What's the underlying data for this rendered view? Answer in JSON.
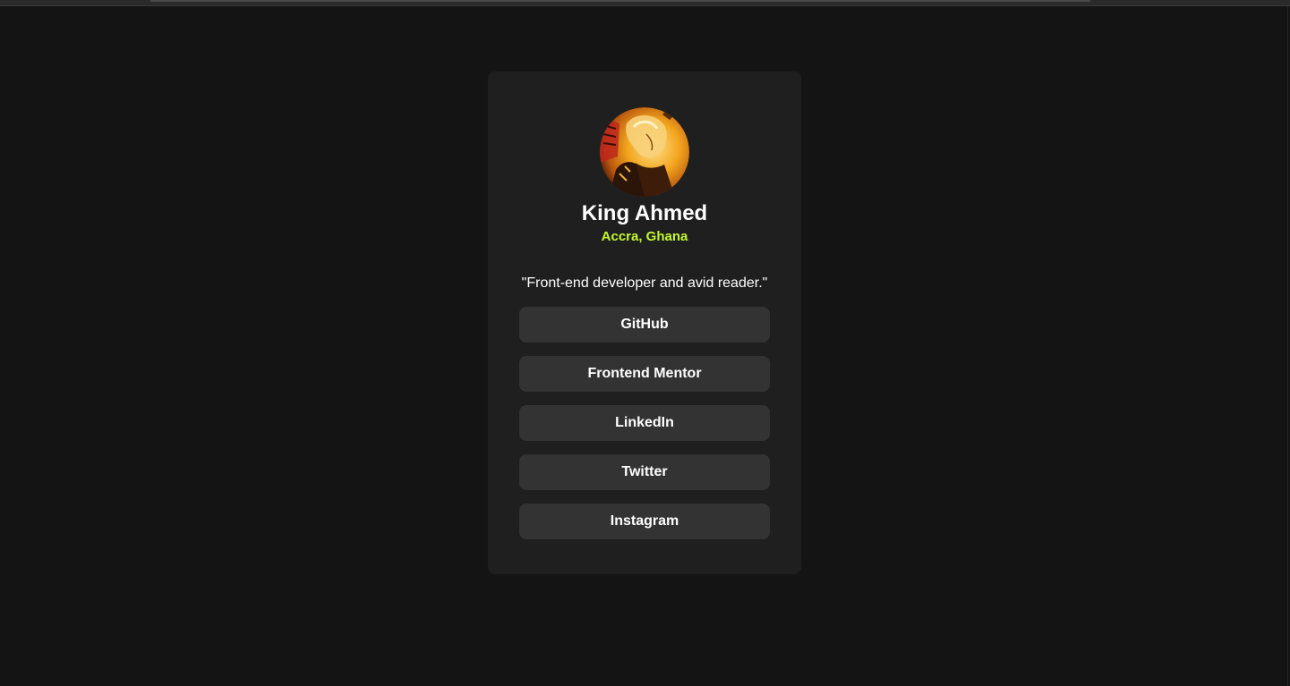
{
  "profile": {
    "name": "King Ahmed",
    "location": "Accra, Ghana",
    "bio": "\"Front-end developer and avid reader.\"",
    "avatar_icon": "anime-character-portrait"
  },
  "links": [
    {
      "label": "GitHub"
    },
    {
      "label": "Frontend Mentor"
    },
    {
      "label": "LinkedIn"
    },
    {
      "label": "Twitter"
    },
    {
      "label": "Instagram"
    }
  ],
  "colors": {
    "page_background": "#141414",
    "card_background": "#1f1f1f",
    "button_background": "#333333",
    "accent": "#c4f82a",
    "text": "#ffffff"
  }
}
